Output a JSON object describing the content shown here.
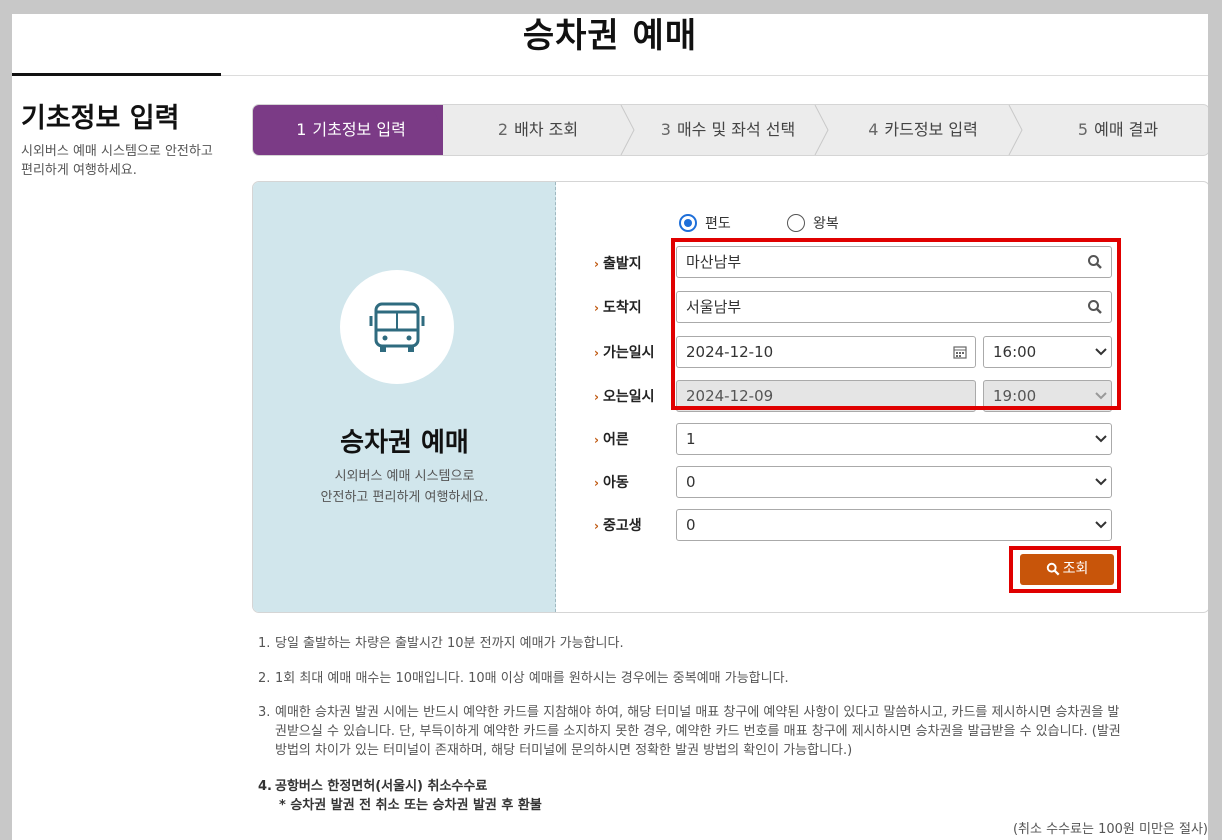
{
  "page": {
    "title": "승차권 예매"
  },
  "side": {
    "heading": "기초정보 입력",
    "description": "시외버스 예매 시스템으로 안전하고 편리하게 여행하세요."
  },
  "steps": [
    {
      "num": "1",
      "label": "기초정보 입력",
      "active": true
    },
    {
      "num": "2",
      "label": "배차 조회",
      "active": false
    },
    {
      "num": "3",
      "label": "매수 및 좌석 선택",
      "active": false
    },
    {
      "num": "4",
      "label": "카드정보 입력",
      "active": false
    },
    {
      "num": "5",
      "label": "예매 결과",
      "active": false
    }
  ],
  "panel": {
    "title": "승차권 예매",
    "desc_line1": "시외버스 예매 시스템으로",
    "desc_line2": "안전하고 편리하게 여행하세요.",
    "icon": "bus-icon"
  },
  "trip_type": {
    "options": [
      "편도",
      "왕복"
    ],
    "selected": "편도"
  },
  "form": {
    "departure": {
      "label": "출발지",
      "value": "마산남부"
    },
    "arrival": {
      "label": "도착지",
      "value": "서울남부"
    },
    "go_date": {
      "label": "가는일시",
      "date": "2024-12-10",
      "time": "16:00"
    },
    "return_date": {
      "label": "오는일시",
      "date": "2024-12-09",
      "time": "19:00"
    },
    "adult": {
      "label": "어른",
      "value": "1"
    },
    "child": {
      "label": "아동",
      "value": "0"
    },
    "student": {
      "label": "중고생",
      "value": "0"
    },
    "search_label": "조회"
  },
  "notes": {
    "n1": "1.",
    "t1": "당일 출발하는 차량은 출발시간 10분 전까지 예매가 가능합니다.",
    "n2": "2.",
    "t2": "1회 최대 예매 매수는 10매입니다. 10매 이상 예매를 원하시는 경우에는 중복예매 가능합니다.",
    "n3": "3.",
    "t3a": "예매한 승차권 발권 시에는 반드시 예약한 카드를 지참해야 하여, 해당 터미널 매표 창구에 예약된 사항이 있다고 말씀하시고, 카드를 제시하시면 승차권을 발",
    "t3b": "권받으실 수 있습니다. 단, 부득이하게 예약한 카드를 소지하지 못한 경우, 예약한 카드 번호를 매표 창구에 제시하시면 승차권을 발급받을 수 있습니다. (발권",
    "t3c": "방법의 차이가 있는 터미널이 존재하며, 해당 터미널에 문의하시면 정확한 발권 방법의 확인이 가능합니다.)",
    "n4": "4.",
    "t4": "공항버스 한정면허(서울시) 취소수수료",
    "t4b": "* 승차권 발권 전 취소 또는 승차권 발권 후 환불",
    "fee": "(취소 수수료는 100원 미만은 절사)"
  },
  "colors": {
    "step_active": "#7b3b86",
    "accent_orange": "#c8550a",
    "highlight_red": "#e00000",
    "radio_blue": "#1e6fd9",
    "panel_bg": "#d1e6ec"
  }
}
